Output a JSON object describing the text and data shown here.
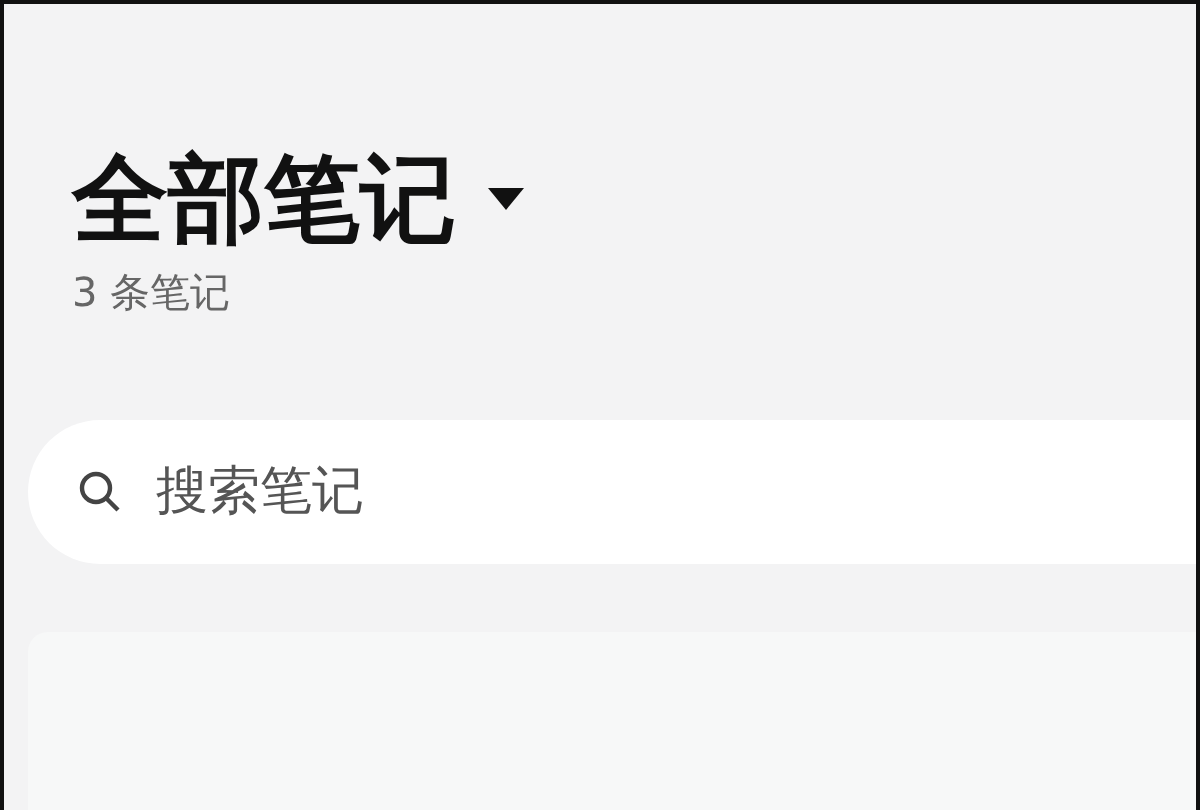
{
  "header": {
    "title": "全部笔记",
    "count": "3 条笔记"
  },
  "search": {
    "placeholder": "搜索笔记"
  }
}
